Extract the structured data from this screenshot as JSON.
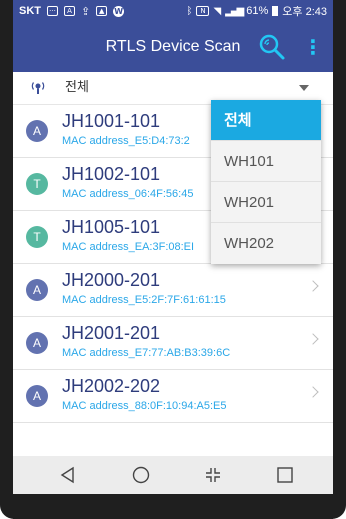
{
  "statusbar": {
    "carrier": "SKT",
    "left_icons": [
      "message-icon",
      "a-icon",
      "usb-icon",
      "image-icon",
      "w-icon"
    ],
    "right_icons": [
      "bluetooth-icon",
      "nfc-icon",
      "wifi-icon",
      "signal-icon"
    ],
    "battery": "61%",
    "time": "오후 2:43"
  },
  "appbar": {
    "title": "RTLS Device Scan",
    "search_icon": "search-icon",
    "more_icon": "more-vert-icon",
    "accent": "#22c7f4",
    "background": "#3b4e99"
  },
  "filter": {
    "icon": "location-beacon-icon",
    "selected": "전체"
  },
  "dropdown": {
    "options": [
      "전체",
      "WH101",
      "WH201",
      "WH202"
    ],
    "selected_index": 0,
    "selected_color": "#1ba9e1"
  },
  "devices": [
    {
      "badge": "A",
      "badge_color": "#6272b0",
      "name": "JH1001-101",
      "mac": "MAC address_E5:D4:73:2"
    },
    {
      "badge": "T",
      "badge_color": "#56b8a0",
      "name": "JH1002-101",
      "mac": "MAC address_06:4F:56:45"
    },
    {
      "badge": "T",
      "badge_color": "#56b8a0",
      "name": "JH1005-101",
      "mac": "MAC address_EA:3F:08:EI"
    },
    {
      "badge": "A",
      "badge_color": "#6272b0",
      "name": "JH2000-201",
      "mac": "MAC address_E5:2F:7F:61:61:15"
    },
    {
      "badge": "A",
      "badge_color": "#6272b0",
      "name": "JH2001-201",
      "mac": "MAC address_E7:77:AB:B3:39:6C"
    },
    {
      "badge": "A",
      "badge_color": "#6272b0",
      "name": "JH2002-202",
      "mac": "MAC address_88:0F:10:94:A5:E5"
    }
  ],
  "navbar": {
    "buttons": [
      "back-icon",
      "home-icon",
      "recents-collapse-icon",
      "square-icon"
    ]
  }
}
